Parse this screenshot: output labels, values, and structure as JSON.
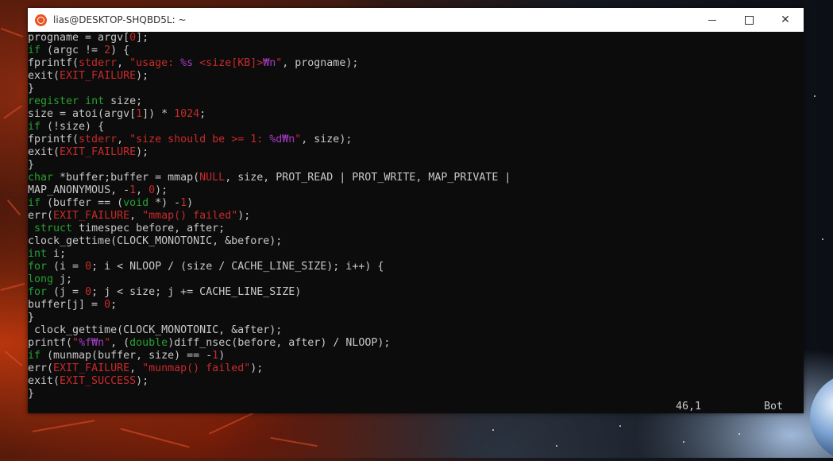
{
  "window": {
    "title": "lias@DESKTOP-SHQBD5L: ~",
    "controls": {
      "minimize": "minimize",
      "maximize": "maximize",
      "close": "✕"
    }
  },
  "editor": {
    "lines": [
      [
        {
          "t": "progname = argv["
        },
        {
          "t": "0",
          "c": "red"
        },
        {
          "t": "];"
        }
      ],
      [
        {
          "t": "if",
          "c": "kw"
        },
        {
          "t": " (argc != "
        },
        {
          "t": "2",
          "c": "red"
        },
        {
          "t": ") {"
        }
      ],
      [
        {
          "t": "fprintf("
        },
        {
          "t": "stderr",
          "c": "red"
        },
        {
          "t": ", "
        },
        {
          "t": "\"usage: ",
          "c": "str"
        },
        {
          "t": "%s",
          "c": "fmt"
        },
        {
          "t": " <size[KB]>",
          "c": "str"
        },
        {
          "t": "₩n",
          "c": "fmt"
        },
        {
          "t": "\"",
          "c": "str"
        },
        {
          "t": ", progname);"
        }
      ],
      [
        {
          "t": "exit("
        },
        {
          "t": "EXIT_FAILURE",
          "c": "red"
        },
        {
          "t": ");"
        }
      ],
      [
        {
          "t": "}"
        }
      ],
      [
        {
          "t": "register",
          "c": "kw"
        },
        {
          "t": " "
        },
        {
          "t": "int",
          "c": "kw"
        },
        {
          "t": " size;"
        }
      ],
      [
        {
          "t": "size = atoi(argv["
        },
        {
          "t": "1",
          "c": "red"
        },
        {
          "t": "]) * "
        },
        {
          "t": "1024",
          "c": "red"
        },
        {
          "t": ";"
        }
      ],
      [
        {
          "t": "if",
          "c": "kw"
        },
        {
          "t": " (!size) {"
        }
      ],
      [
        {
          "t": "fprintf("
        },
        {
          "t": "stderr",
          "c": "red"
        },
        {
          "t": ", "
        },
        {
          "t": "\"size should be >= 1: ",
          "c": "str"
        },
        {
          "t": "%d₩n",
          "c": "fmt"
        },
        {
          "t": "\"",
          "c": "str"
        },
        {
          "t": ", size);"
        }
      ],
      [
        {
          "t": "exit("
        },
        {
          "t": "EXIT_FAILURE",
          "c": "red"
        },
        {
          "t": ");"
        }
      ],
      [
        {
          "t": "}"
        }
      ],
      [
        {
          "t": "char",
          "c": "kw"
        },
        {
          "t": " *buffer;buffer = mmap("
        },
        {
          "t": "NULL",
          "c": "red"
        },
        {
          "t": ", size, PROT_READ | PROT_WRITE, MAP_PRIVATE |"
        }
      ],
      [
        {
          "t": "MAP_ANONYMOUS, -"
        },
        {
          "t": "1",
          "c": "red"
        },
        {
          "t": ", "
        },
        {
          "t": "0",
          "c": "red"
        },
        {
          "t": ");"
        }
      ],
      [
        {
          "t": "if",
          "c": "kw"
        },
        {
          "t": " (buffer == ("
        },
        {
          "t": "void",
          "c": "kw"
        },
        {
          "t": " *) -"
        },
        {
          "t": "1",
          "c": "red"
        },
        {
          "t": ")"
        }
      ],
      [
        {
          "t": "err("
        },
        {
          "t": "EXIT_FAILURE",
          "c": "red"
        },
        {
          "t": ", "
        },
        {
          "t": "\"mmap() failed\"",
          "c": "str"
        },
        {
          "t": ");"
        }
      ],
      [
        {
          "t": " "
        },
        {
          "t": "struct",
          "c": "kw"
        },
        {
          "t": " timespec before, after;"
        }
      ],
      [
        {
          "t": "clock_gettime(CLOCK_MONOTONIC, &before);"
        }
      ],
      [
        {
          "t": "int",
          "c": "kw"
        },
        {
          "t": " i;"
        }
      ],
      [
        {
          "t": "for",
          "c": "kw"
        },
        {
          "t": " (i = "
        },
        {
          "t": "0",
          "c": "red"
        },
        {
          "t": "; i < NLOOP / (size / CACHE_LINE_SIZE); i++) {"
        }
      ],
      [
        {
          "t": "long",
          "c": "kw"
        },
        {
          "t": " j;"
        }
      ],
      [
        {
          "t": "for",
          "c": "kw"
        },
        {
          "t": " (j = "
        },
        {
          "t": "0",
          "c": "red"
        },
        {
          "t": "; j < size; j += CACHE_LINE_SIZE)"
        }
      ],
      [
        {
          "t": "buffer[j] = "
        },
        {
          "t": "0",
          "c": "red"
        },
        {
          "t": ";"
        }
      ],
      [
        {
          "t": "}"
        }
      ],
      [
        {
          "t": " clock_gettime(CLOCK_MONOTONIC, &after);"
        }
      ],
      [
        {
          "t": "printf("
        },
        {
          "t": "\"",
          "c": "str"
        },
        {
          "t": "%f₩n",
          "c": "fmt"
        },
        {
          "t": "\"",
          "c": "str"
        },
        {
          "t": ", ("
        },
        {
          "t": "double",
          "c": "kw"
        },
        {
          "t": ")diff_nsec(before, after) / NLOOP);"
        }
      ],
      [
        {
          "t": "if",
          "c": "kw"
        },
        {
          "t": " (munmap(buffer, size) == -"
        },
        {
          "t": "1",
          "c": "red"
        },
        {
          "t": ")"
        }
      ],
      [
        {
          "t": "err("
        },
        {
          "t": "EXIT_FAILURE",
          "c": "red"
        },
        {
          "t": ", "
        },
        {
          "t": "\"munmap() failed\"",
          "c": "str"
        },
        {
          "t": ");"
        }
      ],
      [
        {
          "t": "exit("
        },
        {
          "t": "EXIT_SUCCESS",
          "c": "red"
        },
        {
          "t": ");"
        }
      ],
      [
        {
          "t": "}"
        }
      ]
    ]
  },
  "status_bar": {
    "position": "46,1",
    "scroll": "Bot"
  },
  "colors": {
    "keyword": "#26a12f",
    "constant": "#c72a2a",
    "format": "#a43cc3",
    "text": "#c8c8c8",
    "background": "#0c0c0c"
  },
  "icons": {
    "app": "ubuntu-icon"
  }
}
